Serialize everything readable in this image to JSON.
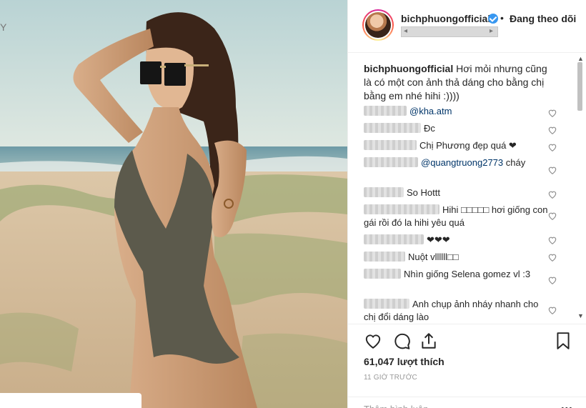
{
  "header": {
    "username": "bichphuongofficial",
    "follow_separator": "•",
    "follow_status": "Đang theo dõi"
  },
  "caption": {
    "username": "bichphuongofficial",
    "text": "Hơi mỏi nhưng cũng là có một con ảnh thả dáng cho bằng chị bằng em nhé hihi :))))"
  },
  "comments": [
    {
      "text": "",
      "mention": "@kha.atm"
    },
    {
      "text": "Đc",
      "mention": ""
    },
    {
      "text": "Chị Phương đẹp quá ❤",
      "mention": ""
    },
    {
      "text": " cháy",
      "mention": "@quangtruong2773"
    },
    {
      "text": "So Hottt",
      "mention": ""
    },
    {
      "text": "Hihi □□□□□ hơi giống con gái rồi đó la hihi yêu quá",
      "mention": ""
    },
    {
      "text": "❤❤❤",
      "mention": ""
    },
    {
      "text": "Nuột vllllll□□",
      "mention": ""
    },
    {
      "text": "Nhìn giống Selena gomez vl :3",
      "mention": ""
    },
    {
      "text": "Anh chụp ảnh nháy nhanh cho chị đổi dáng lào",
      "mention": ""
    }
  ],
  "actions": {
    "like_icon": "heart-icon",
    "comment_icon": "comment-icon",
    "share_icon": "share-icon",
    "save_icon": "bookmark-icon"
  },
  "likes": "61,047 lượt thích",
  "timestamp": "11 GIỜ TRƯỚC",
  "add_comment": {
    "placeholder": "Thêm bình luận..."
  },
  "more_icon": "•••",
  "left_edge_glyph": "Y",
  "colors": {
    "verified": "#3897f0",
    "mention": "#003569",
    "divider": "#efefef"
  }
}
